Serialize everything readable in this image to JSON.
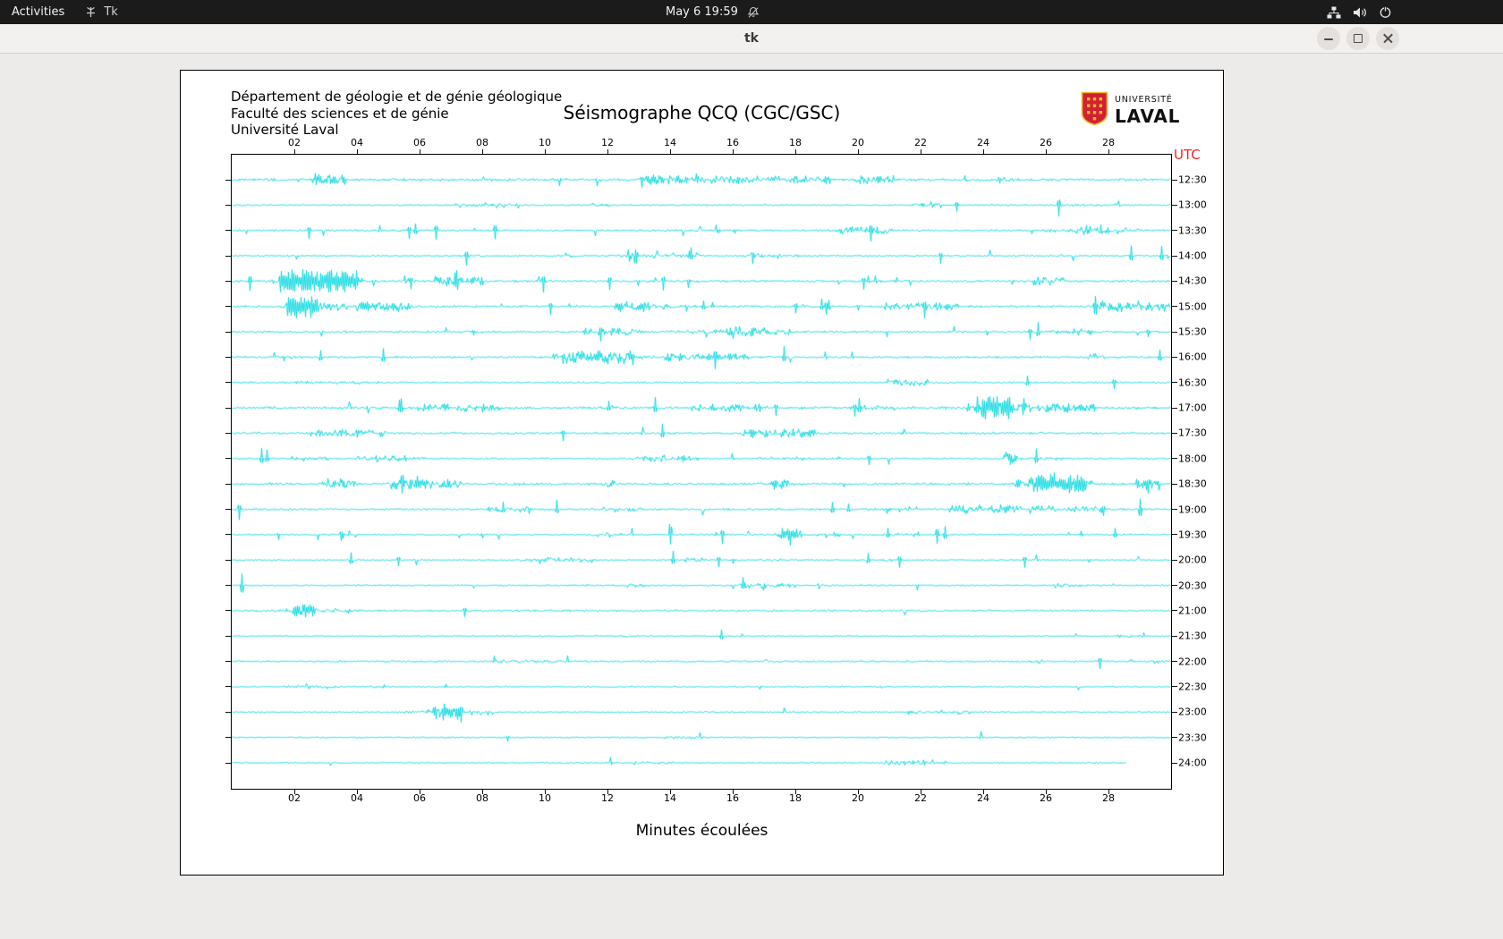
{
  "topbar": {
    "activities": "Activities",
    "app_name": "Tk",
    "clock": "May 6 19:59"
  },
  "titlebar": {
    "title": "tk"
  },
  "icons": {
    "tk_app": "tk-app-icon",
    "notifications": "bell-crossed-icon",
    "network": "network-nodes-icon",
    "volume": "speaker-icon",
    "power": "power-icon",
    "window_controls": [
      "minimize",
      "maximize",
      "close"
    ]
  },
  "seismograph": {
    "header_lines": [
      "Département de géologie et de génie géologique",
      "Faculté des sciences et de génie",
      "Université Laval"
    ],
    "title": "Séismographe QCQ (CGC/GSC)",
    "utc": "UTC",
    "xlabel": "Minutes écoulées",
    "logo": {
      "top": "UNIVERSITÉ",
      "bottom": "LAVAL"
    },
    "x_ticks": [
      "02",
      "04",
      "06",
      "08",
      "10",
      "12",
      "14",
      "16",
      "18",
      "20",
      "22",
      "24",
      "26",
      "28"
    ],
    "x_axis_minutes": 30,
    "time_labels": [
      "12:30",
      "13:00",
      "13:30",
      "14:00",
      "14:30",
      "15:00",
      "15:30",
      "16:00",
      "16:30",
      "17:00",
      "17:30",
      "18:00",
      "18:30",
      "19:00",
      "19:30",
      "20:00",
      "20:30",
      "21:00",
      "21:30",
      "22:00",
      "22:30",
      "23:00",
      "23:30",
      "24:00"
    ],
    "row_activity": [
      0.95,
      0.9,
      1.0,
      0.8,
      1.0,
      1.0,
      0.85,
      0.95,
      0.8,
      1.0,
      0.95,
      0.85,
      0.9,
      0.85,
      0.9,
      0.75,
      0.6,
      0.55,
      0.5,
      0.45,
      0.4,
      0.38,
      0.34,
      0.3
    ],
    "last_trace_fraction": 0.952,
    "colors": {
      "trace": "#00d7df",
      "utc": "#ff1f1f",
      "shield_red": "#d41f33",
      "shield_gold": "#eebe2a"
    }
  }
}
